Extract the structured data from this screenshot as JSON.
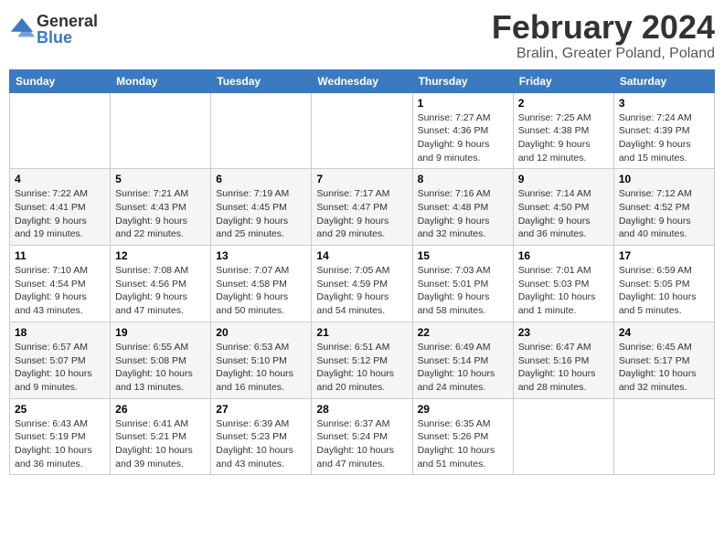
{
  "logo": {
    "general": "General",
    "blue": "Blue"
  },
  "title": {
    "month": "February 2024",
    "location": "Bralin, Greater Poland, Poland"
  },
  "weekdays": [
    "Sunday",
    "Monday",
    "Tuesday",
    "Wednesday",
    "Thursday",
    "Friday",
    "Saturday"
  ],
  "weeks": [
    [
      {
        "day": "",
        "info": ""
      },
      {
        "day": "",
        "info": ""
      },
      {
        "day": "",
        "info": ""
      },
      {
        "day": "",
        "info": ""
      },
      {
        "day": "1",
        "info": "Sunrise: 7:27 AM\nSunset: 4:36 PM\nDaylight: 9 hours and 9 minutes."
      },
      {
        "day": "2",
        "info": "Sunrise: 7:25 AM\nSunset: 4:38 PM\nDaylight: 9 hours and 12 minutes."
      },
      {
        "day": "3",
        "info": "Sunrise: 7:24 AM\nSunset: 4:39 PM\nDaylight: 9 hours and 15 minutes."
      }
    ],
    [
      {
        "day": "4",
        "info": "Sunrise: 7:22 AM\nSunset: 4:41 PM\nDaylight: 9 hours and 19 minutes."
      },
      {
        "day": "5",
        "info": "Sunrise: 7:21 AM\nSunset: 4:43 PM\nDaylight: 9 hours and 22 minutes."
      },
      {
        "day": "6",
        "info": "Sunrise: 7:19 AM\nSunset: 4:45 PM\nDaylight: 9 hours and 25 minutes."
      },
      {
        "day": "7",
        "info": "Sunrise: 7:17 AM\nSunset: 4:47 PM\nDaylight: 9 hours and 29 minutes."
      },
      {
        "day": "8",
        "info": "Sunrise: 7:16 AM\nSunset: 4:48 PM\nDaylight: 9 hours and 32 minutes."
      },
      {
        "day": "9",
        "info": "Sunrise: 7:14 AM\nSunset: 4:50 PM\nDaylight: 9 hours and 36 minutes."
      },
      {
        "day": "10",
        "info": "Sunrise: 7:12 AM\nSunset: 4:52 PM\nDaylight: 9 hours and 40 minutes."
      }
    ],
    [
      {
        "day": "11",
        "info": "Sunrise: 7:10 AM\nSunset: 4:54 PM\nDaylight: 9 hours and 43 minutes."
      },
      {
        "day": "12",
        "info": "Sunrise: 7:08 AM\nSunset: 4:56 PM\nDaylight: 9 hours and 47 minutes."
      },
      {
        "day": "13",
        "info": "Sunrise: 7:07 AM\nSunset: 4:58 PM\nDaylight: 9 hours and 50 minutes."
      },
      {
        "day": "14",
        "info": "Sunrise: 7:05 AM\nSunset: 4:59 PM\nDaylight: 9 hours and 54 minutes."
      },
      {
        "day": "15",
        "info": "Sunrise: 7:03 AM\nSunset: 5:01 PM\nDaylight: 9 hours and 58 minutes."
      },
      {
        "day": "16",
        "info": "Sunrise: 7:01 AM\nSunset: 5:03 PM\nDaylight: 10 hours and 1 minute."
      },
      {
        "day": "17",
        "info": "Sunrise: 6:59 AM\nSunset: 5:05 PM\nDaylight: 10 hours and 5 minutes."
      }
    ],
    [
      {
        "day": "18",
        "info": "Sunrise: 6:57 AM\nSunset: 5:07 PM\nDaylight: 10 hours and 9 minutes."
      },
      {
        "day": "19",
        "info": "Sunrise: 6:55 AM\nSunset: 5:08 PM\nDaylight: 10 hours and 13 minutes."
      },
      {
        "day": "20",
        "info": "Sunrise: 6:53 AM\nSunset: 5:10 PM\nDaylight: 10 hours and 16 minutes."
      },
      {
        "day": "21",
        "info": "Sunrise: 6:51 AM\nSunset: 5:12 PM\nDaylight: 10 hours and 20 minutes."
      },
      {
        "day": "22",
        "info": "Sunrise: 6:49 AM\nSunset: 5:14 PM\nDaylight: 10 hours and 24 minutes."
      },
      {
        "day": "23",
        "info": "Sunrise: 6:47 AM\nSunset: 5:16 PM\nDaylight: 10 hours and 28 minutes."
      },
      {
        "day": "24",
        "info": "Sunrise: 6:45 AM\nSunset: 5:17 PM\nDaylight: 10 hours and 32 minutes."
      }
    ],
    [
      {
        "day": "25",
        "info": "Sunrise: 6:43 AM\nSunset: 5:19 PM\nDaylight: 10 hours and 36 minutes."
      },
      {
        "day": "26",
        "info": "Sunrise: 6:41 AM\nSunset: 5:21 PM\nDaylight: 10 hours and 39 minutes."
      },
      {
        "day": "27",
        "info": "Sunrise: 6:39 AM\nSunset: 5:23 PM\nDaylight: 10 hours and 43 minutes."
      },
      {
        "day": "28",
        "info": "Sunrise: 6:37 AM\nSunset: 5:24 PM\nDaylight: 10 hours and 47 minutes."
      },
      {
        "day": "29",
        "info": "Sunrise: 6:35 AM\nSunset: 5:26 PM\nDaylight: 10 hours and 51 minutes."
      },
      {
        "day": "",
        "info": ""
      },
      {
        "day": "",
        "info": ""
      }
    ]
  ]
}
